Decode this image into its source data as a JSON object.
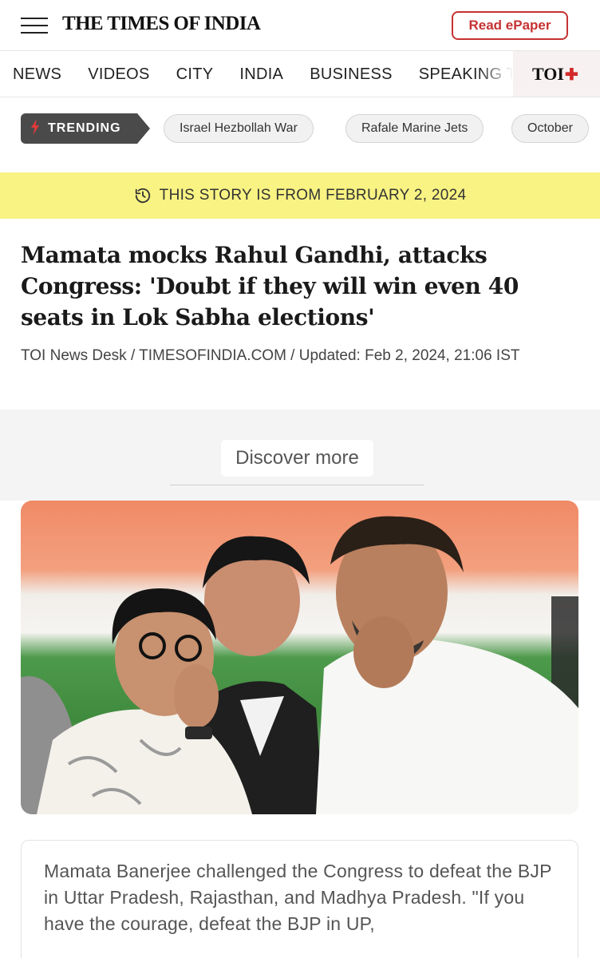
{
  "header": {
    "logo": "THE TIMES OF INDIA",
    "epaper_label": "Read ePaper"
  },
  "nav": {
    "items": [
      {
        "label": "NEWS"
      },
      {
        "label": "VIDEOS"
      },
      {
        "label": "CITY"
      },
      {
        "label": "INDIA"
      },
      {
        "label": "BUSINESS"
      },
      {
        "label": "SPEAKING T"
      }
    ],
    "toi_plus": "TOI",
    "toi_plus_mark": "✚"
  },
  "trending": {
    "label": "TRENDING",
    "chips": [
      {
        "label": "Israel Hezbollah War"
      },
      {
        "label": "Rafale Marine Jets"
      },
      {
        "label": "October"
      }
    ]
  },
  "story_banner": "THIS STORY IS FROM FEBRUARY 2, 2024",
  "article": {
    "headline": "Mamata mocks Rahul Gandhi, attacks Congress: 'Doubt if they will win even 40 seats in Lok Sabha elections'",
    "byline": "TOI News Desk / TIMESOFINDIA.COM / Updated: Feb 2, 2024, 21:06 IST",
    "summary": "Mamata Banerjee challenged the Congress to defeat the BJP in Uttar Pradesh, Rajasthan, and Madhya Pradesh. \"If you have the courage, defeat the BJP in UP,"
  },
  "discover": {
    "label": "Discover more"
  },
  "colors": {
    "brand_red": "#c63232",
    "banner_yellow": "#f8f383",
    "trending_bg": "#4a4a4a"
  }
}
